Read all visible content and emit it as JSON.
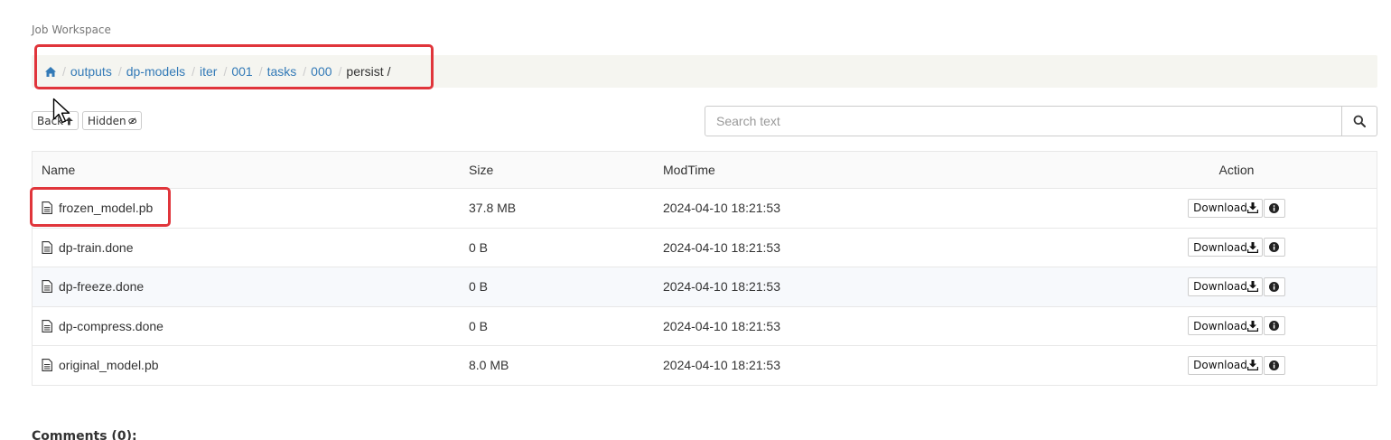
{
  "page": {
    "heading": "Job Workspace"
  },
  "breadcrumb": {
    "home_icon": "home-icon",
    "items": [
      "outputs",
      "dp-models",
      "iter",
      "001",
      "tasks",
      "000"
    ],
    "current": "persist",
    "trailing": "/"
  },
  "toolbar": {
    "back_label": "Back",
    "hidden_label": "Hidden",
    "search_placeholder": "Search text"
  },
  "table": {
    "headers": {
      "name": "Name",
      "size": "Size",
      "modtime": "ModTime",
      "action": "Action"
    },
    "download_label": "Download",
    "rows": [
      {
        "name": "frozen_model.pb",
        "size": "37.8 MB",
        "modtime": "2024-04-10 18:21:53"
      },
      {
        "name": "dp-train.done",
        "size": "0 B",
        "modtime": "2024-04-10 18:21:53"
      },
      {
        "name": "dp-freeze.done",
        "size": "0 B",
        "modtime": "2024-04-10 18:21:53"
      },
      {
        "name": "dp-compress.done",
        "size": "0 B",
        "modtime": "2024-04-10 18:21:53"
      },
      {
        "name": "original_model.pb",
        "size": "8.0 MB",
        "modtime": "2024-04-10 18:21:53"
      }
    ]
  },
  "comments": {
    "label": "Comments (0):"
  },
  "colors": {
    "link": "#337ab7",
    "highlight": "#e0353b",
    "breadcrumb_bg": "#f5f5f0"
  }
}
